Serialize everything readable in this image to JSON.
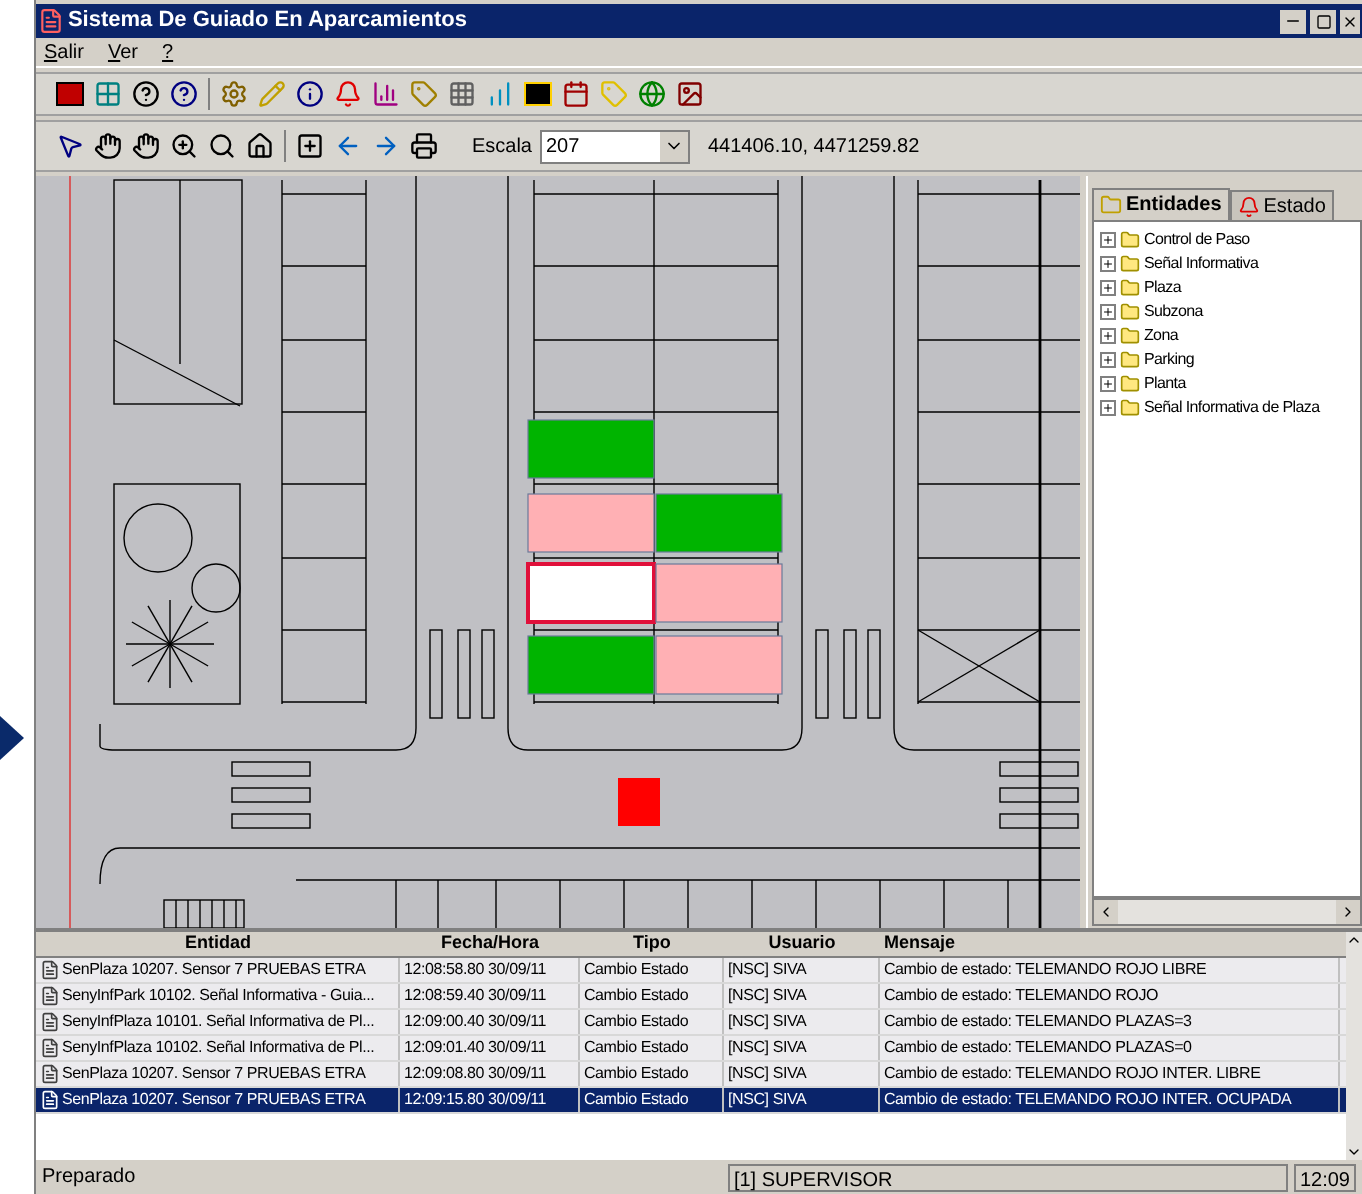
{
  "window": {
    "title": "Sistema De Guiado En Aparcamientos"
  },
  "menu": [
    {
      "label": "Salir"
    },
    {
      "label": "Ver"
    },
    {
      "label": "?"
    }
  ],
  "toolbar2": {
    "scale_label": "Escala",
    "scale_value": "207",
    "coordinates": "441406.10, 4471259.82"
  },
  "map": {
    "spaces": [
      {
        "color": "#00b400",
        "selected": false
      },
      {
        "color": "#ffb0b4",
        "selected": false
      },
      {
        "color": "#00b400",
        "selected": false
      },
      {
        "color": "#ffffff",
        "selected": true
      },
      {
        "color": "#ffb0b4",
        "selected": false
      },
      {
        "color": "#00b400",
        "selected": false
      },
      {
        "color": "#ffb0b4",
        "selected": false
      }
    ],
    "markers": [
      {
        "color": "#ff0000"
      }
    ]
  },
  "panel": {
    "tabs": [
      {
        "label": "Entidades",
        "selected": true
      },
      {
        "label": "Estado",
        "selected": false
      }
    ],
    "tree": [
      {
        "label": "Control de Paso",
        "expanded": false
      },
      {
        "label": "Señal Informativa",
        "expanded": false
      },
      {
        "label": "Plaza",
        "expanded": false
      },
      {
        "label": "Subzona",
        "expanded": false
      },
      {
        "label": "Zona",
        "expanded": false
      },
      {
        "label": "Parking",
        "expanded": false
      },
      {
        "label": "Planta",
        "expanded": false
      },
      {
        "label": "Señal Informativa de Plaza",
        "expanded": false
      }
    ]
  },
  "log": {
    "columns": [
      "Entidad",
      "Fecha/Hora",
      "Tipo",
      "Usuario",
      "Mensaje"
    ],
    "rows": [
      {
        "cells": [
          "SenPlaza 10207. Sensor 7 PRUEBAS ETRA",
          "12:08:58.80 30/09/11",
          "Cambio Estado",
          "[NSC] SIVA",
          "Cambio de estado: TELEMANDO ROJO LIBRE"
        ],
        "selected": false
      },
      {
        "cells": [
          "SenyInfPark 10102. Señal Informativa - Guia...",
          "12:08:59.40 30/09/11",
          "Cambio Estado",
          "[NSC] SIVA",
          "Cambio de estado: TELEMANDO ROJO"
        ],
        "selected": false
      },
      {
        "cells": [
          "SenyInfPlaza 10101. Señal Informativa de Pl...",
          "12:09:00.40 30/09/11",
          "Cambio Estado",
          "[NSC] SIVA",
          "Cambio de estado: TELEMANDO PLAZAS=3"
        ],
        "selected": false
      },
      {
        "cells": [
          "SenyInfPlaza 10102. Señal Informativa de Pl...",
          "12:09:01.40 30/09/11",
          "Cambio Estado",
          "[NSC] SIVA",
          "Cambio de estado: TELEMANDO PLAZAS=0"
        ],
        "selected": false
      },
      {
        "cells": [
          "SenPlaza 10207. Sensor 7 PRUEBAS ETRA",
          "12:09:08.80 30/09/11",
          "Cambio Estado",
          "[NSC] SIVA",
          "Cambio de estado: TELEMANDO ROJO INTER. LIBRE"
        ],
        "selected": false
      },
      {
        "cells": [
          "SenPlaza 10207. Sensor 7 PRUEBAS ETRA",
          "12:09:15.80 30/09/11",
          "Cambio Estado",
          "[NSC] SIVA",
          "Cambio de estado: TELEMANDO ROJO INTER. OCUPADA"
        ],
        "selected": true
      }
    ]
  },
  "status_bar": {
    "message": "Preparado",
    "user": "[1] SUPERVISOR",
    "time": "12:09"
  }
}
